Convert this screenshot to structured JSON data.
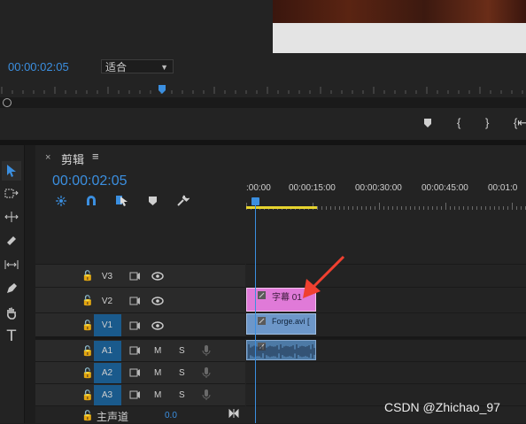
{
  "monitor": {
    "timecode": "00:00:02:05",
    "fit_label": "适合",
    "ctrl_marker": "⬟",
    "ctrl_in": "{",
    "ctrl_out": "}",
    "ctrl_goto_in": "{⇤"
  },
  "timeline": {
    "close": "×",
    "title": "剪辑",
    "menu": "≡",
    "timecode": "00:00:02:05",
    "ruler_labels": [
      ":00:00",
      "00:00:15:00",
      "00:00:30:00",
      "00:00:45:00",
      "00:01:0"
    ],
    "tracks": {
      "v3": "V3",
      "v2": "V2",
      "v1": "V1",
      "a1": "A1",
      "a2": "A2",
      "a3": "A3"
    },
    "mute": "M",
    "solo": "S",
    "master_label": "主声道",
    "master_value": "0.0",
    "clip_title": "字幕 01",
    "clip_video": "Forge.avi ["
  },
  "watermark": "CSDN @Zhichao_97",
  "colors": {
    "accent": "#3b8fe0",
    "title_clip": "#e07ad8",
    "video_clip": "#6d97c9",
    "audio_clip": "#4d7aa6",
    "track_target": "#1a5a8c",
    "work_area": "#e6d32e",
    "annotation_arrow": "#f04030"
  }
}
